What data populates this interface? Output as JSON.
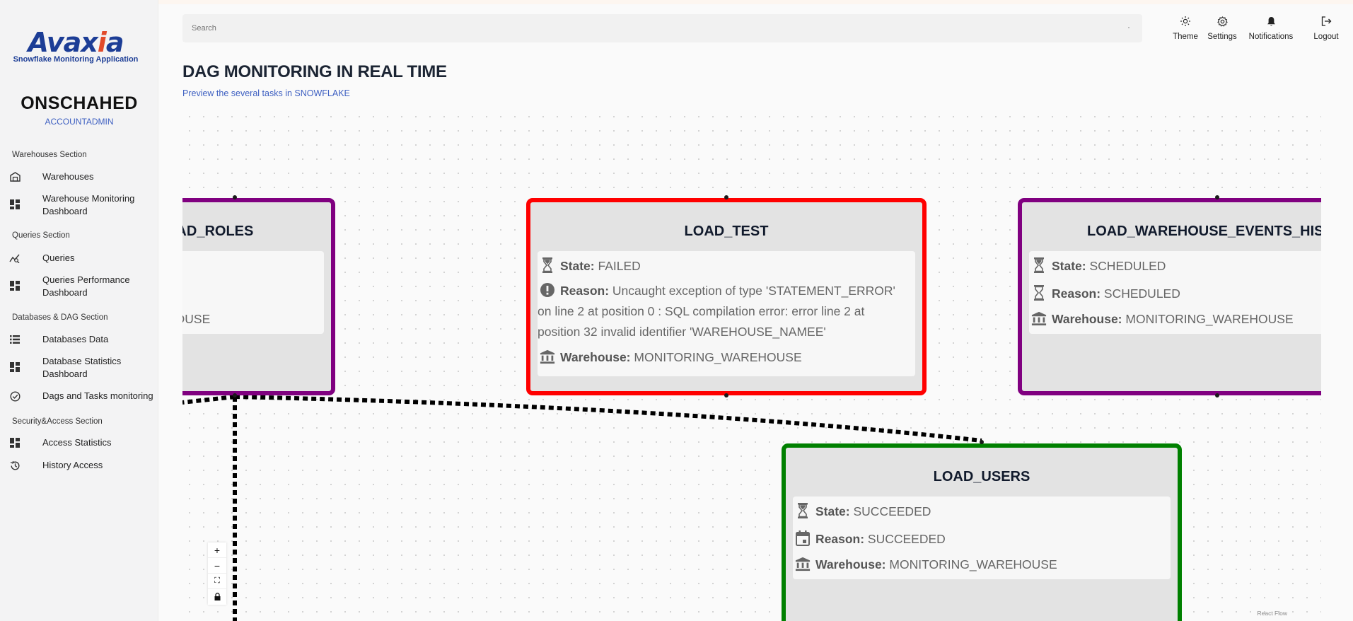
{
  "app": {
    "logo_text_a": "Avax",
    "logo_text_b": "i",
    "logo_text_c": "a",
    "logo_subtitle": "Snowflake Monitoring Application",
    "brand_color": "#1c3d96",
    "accent_color": "#e24a2a"
  },
  "user": {
    "name": "ONSCHAHED",
    "role": "ACCOUNTADMIN"
  },
  "sidebar": {
    "sections": [
      {
        "title": "Warehouses Section"
      },
      {
        "title": "Queries Section"
      },
      {
        "title": "Databases & DAG Section"
      },
      {
        "title": "Security&Access Section"
      }
    ],
    "items": [
      {
        "label": "Warehouses",
        "icon": "warehouse-icon"
      },
      {
        "label": "Warehouse Monitoring Dashboard",
        "icon": "dashboard-icon"
      },
      {
        "label": "Queries",
        "icon": "query-stats-icon"
      },
      {
        "label": "Queries Performance Dashboard",
        "icon": "dashboard-icon"
      },
      {
        "label": "Databases Data",
        "icon": "list-icon"
      },
      {
        "label": "Database Statistics Dashboard",
        "icon": "dashboard-icon"
      },
      {
        "label": "Dags and Tasks monitoring",
        "icon": "check-circle-icon"
      },
      {
        "label": "Access Statistics",
        "icon": "dashboard-icon"
      },
      {
        "label": "History Access",
        "icon": "history-icon"
      }
    ]
  },
  "header": {
    "search_placeholder": "Search",
    "buttons": [
      {
        "label": "Theme",
        "icon": "sun-icon"
      },
      {
        "label": "Settings",
        "icon": "gear-icon"
      },
      {
        "label": "Notifications",
        "icon": "bell-icon"
      },
      {
        "label": "Logout",
        "icon": "logout-icon"
      }
    ]
  },
  "page": {
    "title": "DAG MONITORING IN REAL TIME",
    "subtitle": "Preview the several tasks in SNOWFLAKE"
  },
  "dag": {
    "nodes": [
      {
        "title": "LOAD_ROLES",
        "border_color": "#800080",
        "warehouse_value": "MONITORING_WAREHOUSE"
      },
      {
        "title": "LOAD_TEST",
        "border_color": "#ff0000",
        "state_label": "State:",
        "state_value": "FAILED",
        "reason_label": "Reason:",
        "reason_value": "Uncaught exception of type 'STATEMENT_ERROR' on line 2 at position 0 : SQL compilation error: error line 2 at position 32 invalid identifier 'WAREHOUSE_NAMEE'",
        "warehouse_label": "Warehouse:",
        "warehouse_value": "MONITORING_WAREHOUSE"
      },
      {
        "title": "LOAD_WAREHOUSE_EVENTS_HISTORY",
        "border_color": "#800080",
        "state_label": "State:",
        "state_value": "SCHEDULED",
        "reason_label": "Reason:",
        "reason_value": "SCHEDULED",
        "warehouse_label": "Warehouse:",
        "warehouse_value": "MONITORING_WAREHOUSE"
      },
      {
        "title": "LOAD_USERS",
        "border_color": "#008000",
        "state_label": "State:",
        "state_value": "SUCCEEDED",
        "reason_label": "Reason:",
        "reason_value": "SUCCEEDED",
        "warehouse_label": "Warehouse:",
        "warehouse_value": "MONITORING_WAREHOUSE"
      }
    ],
    "controls": [
      {
        "label": "+",
        "icon": "zoom-in-icon"
      },
      {
        "label": "−",
        "icon": "zoom-out-icon"
      },
      {
        "label": "⛶",
        "icon": "fit-view-icon"
      },
      {
        "label": "",
        "icon": "lock-icon"
      }
    ],
    "attribution": "React Flow"
  }
}
